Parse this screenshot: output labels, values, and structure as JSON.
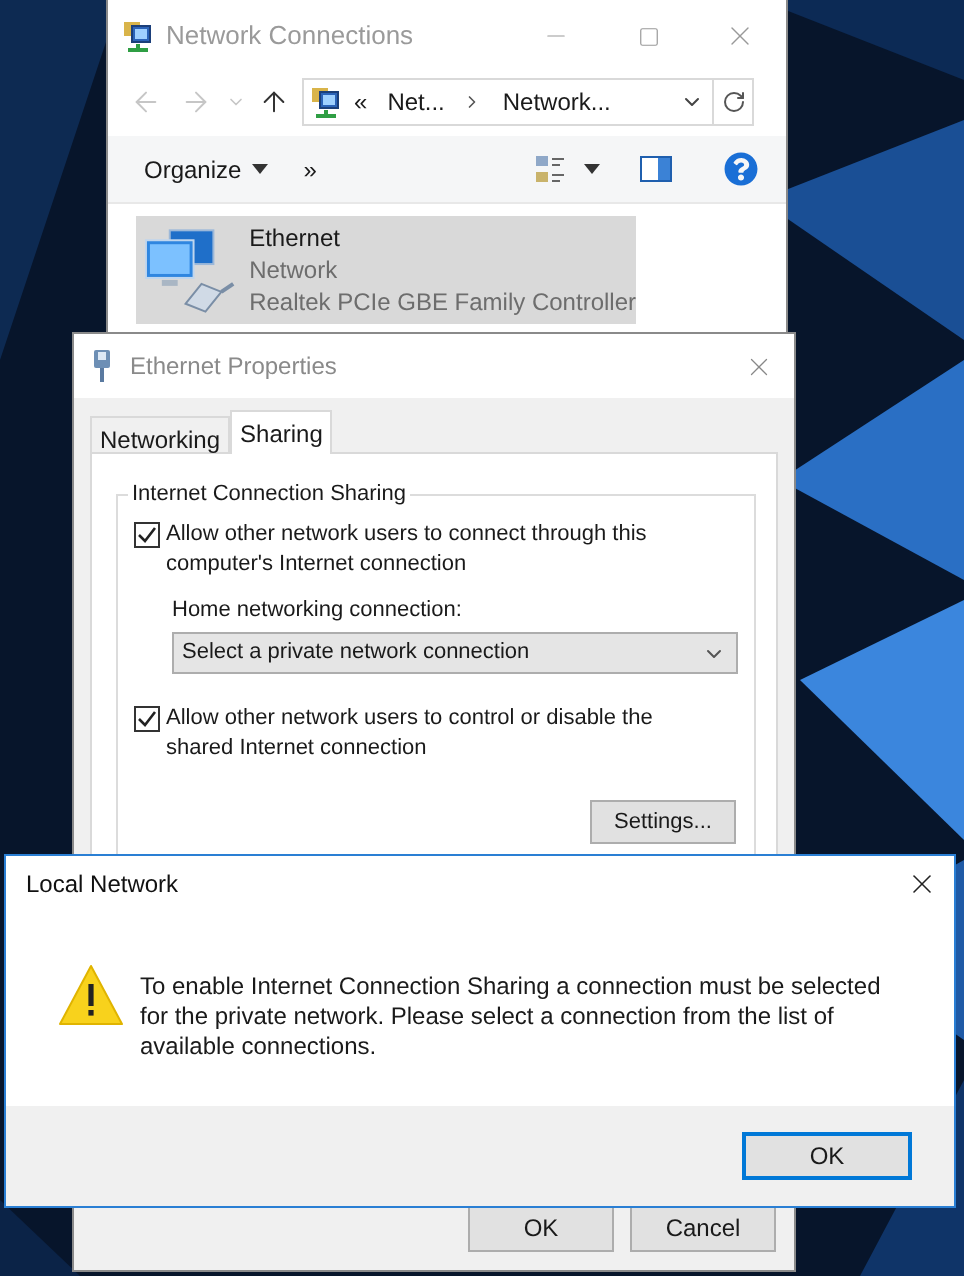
{
  "network_connections": {
    "title": "Network Connections",
    "address": {
      "overflow": "«",
      "crumbs": [
        "Net...",
        "Network..."
      ]
    },
    "toolbar": {
      "organize": "Organize",
      "more": "»"
    },
    "item": {
      "name": "Ethernet",
      "status": "Network",
      "device": "Realtek PCIe GBE Family Controller",
      "selected": true
    }
  },
  "ethernet_properties": {
    "title": "Ethernet Properties",
    "tabs": [
      {
        "label": "Networking",
        "selected": false
      },
      {
        "label": "Sharing",
        "selected": true
      }
    ],
    "group_title": "Internet Connection Sharing",
    "options": [
      {
        "label": "Allow other network users to connect through this computer's Internet connection",
        "checked": true
      },
      {
        "label": "Allow other network users to control or disable the shared Internet connection",
        "checked": true
      }
    ],
    "home_label": "Home networking connection:",
    "home_select": "Select a private network connection",
    "settings_button": "Settings...",
    "buttons": [
      "OK",
      "Cancel"
    ]
  },
  "alert": {
    "title": "Local Network",
    "message": "To enable Internet Connection Sharing a connection must be selected for the private network. Please select a connection from the list of available connections.",
    "button": "OK"
  }
}
